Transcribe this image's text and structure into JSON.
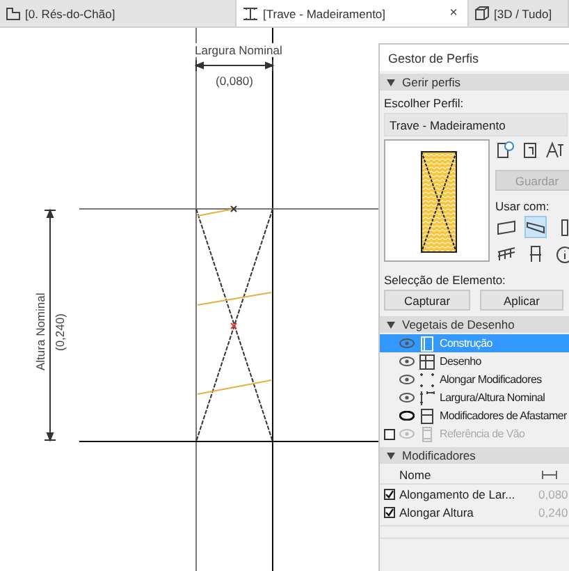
{
  "tabs": [
    {
      "kind": "floor",
      "label": "[0. Rés-do-Chão]",
      "selected": false
    },
    {
      "kind": "beam",
      "label": "[Trave - Madeiramento]",
      "selected": true,
      "close": "×"
    },
    {
      "kind": "cube",
      "label": "[3D / Tudo]",
      "selected": false
    }
  ],
  "canvas": {
    "width_label": "Largura Nominal",
    "width_value": "(0,080)",
    "height_label": "Altura Nominal",
    "height_value": "(0,240)"
  },
  "panel": {
    "title": "Gestor de Perfis",
    "manage": {
      "title": "Gerir perfis",
      "expanded": true,
      "choose_label": "Escolher Perfil:",
      "profile": "Trave - Madeiramento",
      "save_button": {
        "label": "Guardar",
        "disabled": true
      },
      "use_with_label": "Usar com:",
      "use_with": [
        {
          "kind": "wall",
          "selected": false
        },
        {
          "kind": "beam",
          "selected": true
        },
        {
          "kind": "column",
          "selected": false
        },
        {
          "kind": "railing",
          "selected": false
        },
        {
          "kind": "chair",
          "selected": false
        },
        {
          "kind": "info",
          "selected": false
        }
      ],
      "selection_label": "Selecção de Elemento:",
      "buttons": [
        "Capturar",
        "Aplicar"
      ]
    },
    "components": {
      "title": "Vegetais de Desenho",
      "expanded": true,
      "items": [
        {
          "kind": "fixed",
          "label": "Construção",
          "visible": true,
          "selected": true,
          "disabled": false
        },
        {
          "kind": "fixed",
          "label": "Desenho",
          "visible": true,
          "selected": false,
          "disabled": false
        },
        {
          "kind": "fixed",
          "label": "Alongar Modificadores",
          "visible": true,
          "selected": false,
          "disabled": false
        },
        {
          "kind": "fixed",
          "label": "Largura/Altura Nominal",
          "visible": true,
          "selected": false,
          "disabled": false
        },
        {
          "kind": "fixed",
          "label": "Modificadores de Afastamer",
          "visible": false,
          "selected": false,
          "disabled": false
        },
        {
          "kind": "optional",
          "label": "Referência de Vão",
          "visible": true,
          "selected": false,
          "disabled": true,
          "checked": false
        }
      ]
    },
    "modifiers": {
      "title": "Modificadores",
      "expanded": true,
      "name_column": "Nome",
      "rows": [
        {
          "name": "Alongamento de Lar...",
          "value": "0,080",
          "checked": true
        },
        {
          "name": "Alongar Altura",
          "value": "0,240",
          "checked": true
        }
      ]
    }
  }
}
